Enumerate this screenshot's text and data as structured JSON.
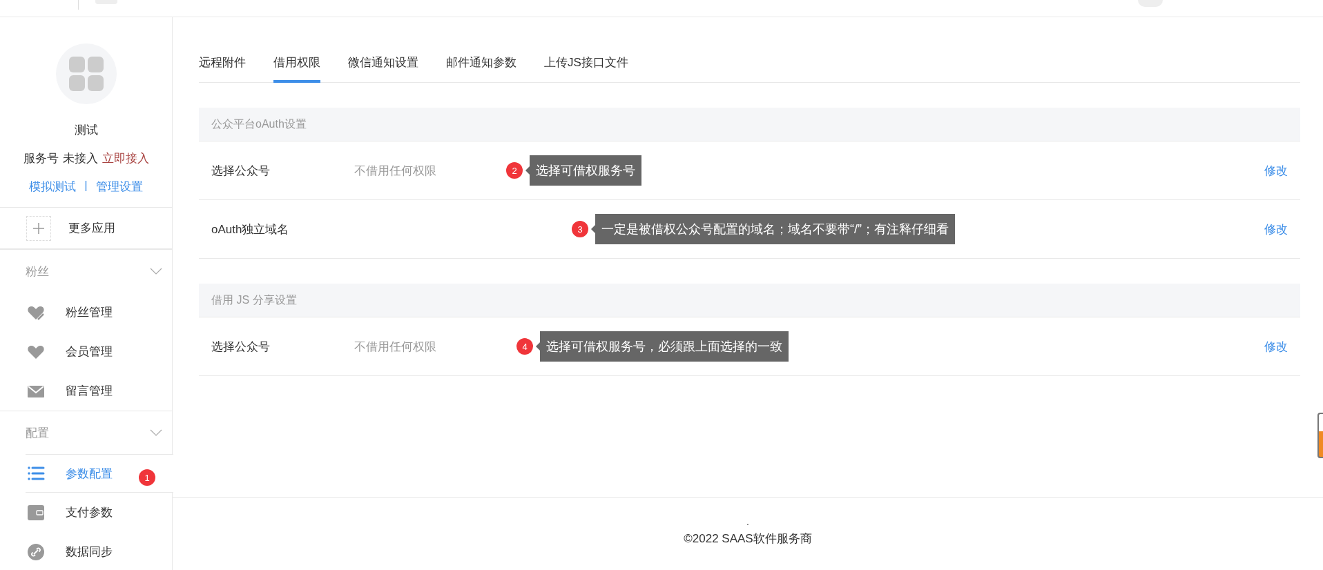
{
  "sidebar": {
    "account": {
      "name": "测试",
      "type_label": "服务号",
      "status": "未接入",
      "connect_link": "立即接入",
      "links": [
        "模拟测试",
        "管理设置"
      ],
      "link_separator": "|"
    },
    "more_apps": "更多应用",
    "groups": [
      {
        "title": "粉丝",
        "expanded": true,
        "items": [
          {
            "label": "粉丝管理",
            "selected": false
          },
          {
            "label": "会员管理",
            "selected": false
          },
          {
            "label": "留言管理",
            "selected": false
          }
        ]
      },
      {
        "title": "配置",
        "expanded": true,
        "items": [
          {
            "label": "参数配置",
            "selected": true,
            "annotation": "1"
          },
          {
            "label": "支付参数",
            "selected": false
          },
          {
            "label": "数据同步",
            "selected": false
          }
        ]
      }
    ]
  },
  "tabs": [
    {
      "label": "远程附件",
      "selected": false
    },
    {
      "label": "借用权限",
      "selected": true
    },
    {
      "label": "微信通知设置",
      "selected": false
    },
    {
      "label": "邮件通知参数",
      "selected": false
    },
    {
      "label": "上传JS接口文件",
      "selected": false
    }
  ],
  "sections": [
    {
      "title": "公众平台oAuth设置",
      "rows": [
        {
          "label": "选择公众号",
          "value": "不借用任何权限",
          "action": "修改",
          "annotation": {
            "number": "2",
            "text": "选择可借权服务号"
          }
        },
        {
          "label": "oAuth独立域名",
          "action": "修改",
          "annotation": {
            "number": "3",
            "text": "一定是被借权公众号配置的域名；域名不要带“/”；有注释仔细看"
          }
        }
      ]
    },
    {
      "title": "借用 JS 分享设置",
      "rows": [
        {
          "label": "选择公众号",
          "value": "不借用任何权限",
          "action": "修改",
          "annotation": {
            "number": "4",
            "text": "选择可借权服务号，必须跟上面选择的一致"
          }
        }
      ]
    }
  ],
  "footer": {
    "dot": ".",
    "copyright": "©2022 SAAS软件服务商"
  }
}
